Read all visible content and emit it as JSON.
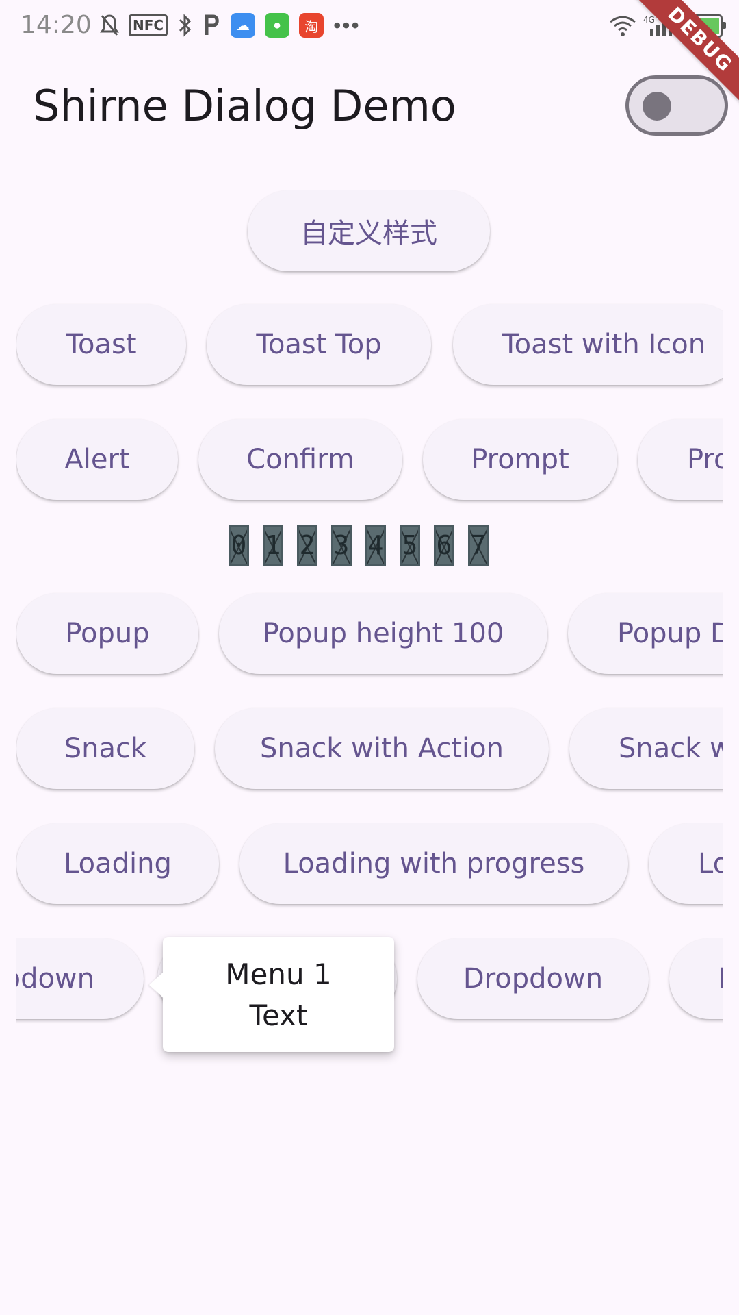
{
  "status_bar": {
    "time": "14:20",
    "nfc_label": "NFC",
    "icons_left": [
      "bell-off-icon",
      "nfc-icon",
      "bluetooth-icon",
      "p-icon",
      "cloud-app-icon",
      "message-app-icon",
      "taobao-app-icon",
      "more-dots-icon"
    ],
    "icons_right": [
      "wifi-icon",
      "signal-4g-icon",
      "battery-icon"
    ],
    "network": "4G",
    "overflow": "•••"
  },
  "debug_banner": "DEBUG",
  "app_bar": {
    "title": "Shirne Dialog Demo",
    "theme_switch_on": false
  },
  "buttons": {
    "custom_style": "自定义样式",
    "row_toast": [
      "Toast",
      "Toast Top",
      "Toast with Icon"
    ],
    "row_alert": [
      "Alert",
      "Confirm",
      "Prompt",
      "Pro"
    ],
    "digits": [
      "0",
      "1",
      "2",
      "3",
      "4",
      "5",
      "6",
      "7"
    ],
    "row_popup": [
      "Popup",
      "Popup height 100",
      "Popup D"
    ],
    "row_snack": [
      "Snack",
      "Snack with Action",
      "Snack w"
    ],
    "row_loading": [
      "Loading",
      "Loading with progress",
      "Lo"
    ],
    "row_dropdown": [
      "pdown",
      "Dropdown",
      "I"
    ]
  },
  "menu_popup": {
    "line1": "Menu 1",
    "line2": "Text"
  },
  "colors": {
    "background": "#fdf7fe",
    "button_bg": "#f7f2fa",
    "button_text": "#65558f",
    "debug_banner": "#b23b3b"
  }
}
